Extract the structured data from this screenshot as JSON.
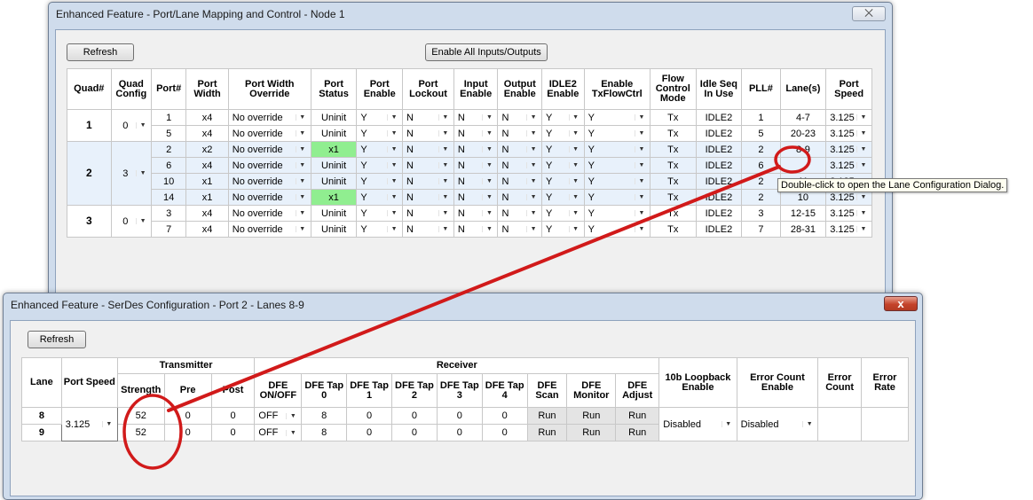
{
  "win1": {
    "title": "Enhanced Feature - Port/Lane Mapping and Control - Node 1",
    "close": "⨉",
    "refresh": "Refresh",
    "enable_all": "Enable All Inputs/Outputs"
  },
  "win2": {
    "title": "Enhanced Feature - SerDes Configuration - Port 2 - Lanes 8-9",
    "close": "x",
    "refresh": "Refresh"
  },
  "tooltip": "Double-click to open the Lane Configuration Dialog.",
  "colors": {
    "annotation": "#d11a1a",
    "active_status": "#90ee90",
    "selected_rows": "#e8f1fb"
  },
  "t1": {
    "headers": [
      "Quad#",
      "Quad Config",
      "Port#",
      "Port Width",
      "Port Width Override",
      "Port Status",
      "Port Enable",
      "Port Lockout",
      "Input Enable",
      "Output Enable",
      "IDLE2 Enable",
      "Enable TxFlowCtrl",
      "Flow Control Mode",
      "Idle Seq In Use",
      "PLL#",
      "Lane(s)",
      "Port Speed"
    ],
    "quads": [
      {
        "quad": "1",
        "config": "0"
      },
      {
        "quad": "2",
        "config": "3"
      },
      {
        "quad": "3",
        "config": "0"
      }
    ],
    "rows": [
      {
        "port": "1",
        "width": "x4",
        "override": "No override",
        "status": "Uninit",
        "enable": "Y",
        "lockout": "N",
        "input": "N",
        "output": "N",
        "idle2": "Y",
        "txflow": "Y",
        "flowmode": "Tx",
        "idleseq": "IDLE2",
        "pll": "1",
        "lanes": "4-7",
        "speed": "3.125"
      },
      {
        "port": "5",
        "width": "x4",
        "override": "No override",
        "status": "Uninit",
        "enable": "Y",
        "lockout": "N",
        "input": "N",
        "output": "N",
        "idle2": "Y",
        "txflow": "Y",
        "flowmode": "Tx",
        "idleseq": "IDLE2",
        "pll": "5",
        "lanes": "20-23",
        "speed": "3.125"
      },
      {
        "port": "2",
        "width": "x2",
        "override": "No override",
        "status": "x1",
        "enable": "Y",
        "lockout": "N",
        "input": "N",
        "output": "N",
        "idle2": "Y",
        "txflow": "Y",
        "flowmode": "Tx",
        "idleseq": "IDLE2",
        "pll": "2",
        "lanes": "8-9",
        "speed": "3.125"
      },
      {
        "port": "6",
        "width": "x4",
        "override": "No override",
        "status": "Uninit",
        "enable": "Y",
        "lockout": "N",
        "input": "N",
        "output": "N",
        "idle2": "Y",
        "txflow": "Y",
        "flowmode": "Tx",
        "idleseq": "IDLE2",
        "pll": "6",
        "lanes": "",
        "speed": "3.125"
      },
      {
        "port": "10",
        "width": "x1",
        "override": "No override",
        "status": "Uninit",
        "enable": "Y",
        "lockout": "N",
        "input": "N",
        "output": "N",
        "idle2": "Y",
        "txflow": "Y",
        "flowmode": "Tx",
        "idleseq": "IDLE2",
        "pll": "2",
        "lanes": "11",
        "speed": "3.125"
      },
      {
        "port": "14",
        "width": "x1",
        "override": "No override",
        "status": "x1",
        "enable": "Y",
        "lockout": "N",
        "input": "N",
        "output": "N",
        "idle2": "Y",
        "txflow": "Y",
        "flowmode": "Tx",
        "idleseq": "IDLE2",
        "pll": "2",
        "lanes": "10",
        "speed": "3.125"
      },
      {
        "port": "3",
        "width": "x4",
        "override": "No override",
        "status": "Uninit",
        "enable": "Y",
        "lockout": "N",
        "input": "N",
        "output": "N",
        "idle2": "Y",
        "txflow": "Y",
        "flowmode": "Tx",
        "idleseq": "IDLE2",
        "pll": "3",
        "lanes": "12-15",
        "speed": "3.125"
      },
      {
        "port": "7",
        "width": "x4",
        "override": "No override",
        "status": "Uninit",
        "enable": "Y",
        "lockout": "N",
        "input": "N",
        "output": "N",
        "idle2": "Y",
        "txflow": "Y",
        "flowmode": "Tx",
        "idleseq": "IDLE2",
        "pll": "7",
        "lanes": "28-31",
        "speed": "3.125"
      }
    ]
  },
  "t2": {
    "h_lane": "Lane",
    "h_speed": "Port Speed",
    "h_tx": "Transmitter",
    "h_rx": "Receiver",
    "h_strength": "Strength",
    "h_pre": "Pre",
    "h_post": "Post",
    "h_dfe_onoff": "DFE ON/OFF",
    "h_tap0": "DFE Tap 0",
    "h_tap1": "DFE Tap 1",
    "h_tap2": "DFE Tap 2",
    "h_tap3": "DFE Tap 3",
    "h_tap4": "DFE Tap 4",
    "h_scan": "DFE Scan",
    "h_monitor": "DFE Monitor",
    "h_adjust": "DFE Adjust",
    "h_loopback": "10b Loopback Enable",
    "h_errcount_en": "Error Count Enable",
    "h_errcount": "Error Count",
    "h_errrate": "Error Rate",
    "speed": "3.125",
    "loopback": "Disabled",
    "errcount_en": "Disabled",
    "rows": [
      {
        "lane": "8",
        "strength": "52",
        "pre": "0",
        "post": "0",
        "dfe": "OFF",
        "tap0": "8",
        "tap1": "0",
        "tap2": "0",
        "tap3": "0",
        "tap4": "0",
        "scan": "Run",
        "monitor": "Run",
        "adjust": "Run"
      },
      {
        "lane": "9",
        "strength": "52",
        "pre": "0",
        "post": "0",
        "dfe": "OFF",
        "tap0": "8",
        "tap1": "0",
        "tap2": "0",
        "tap3": "0",
        "tap4": "0",
        "scan": "Run",
        "monitor": "Run",
        "adjust": "Run"
      }
    ]
  }
}
